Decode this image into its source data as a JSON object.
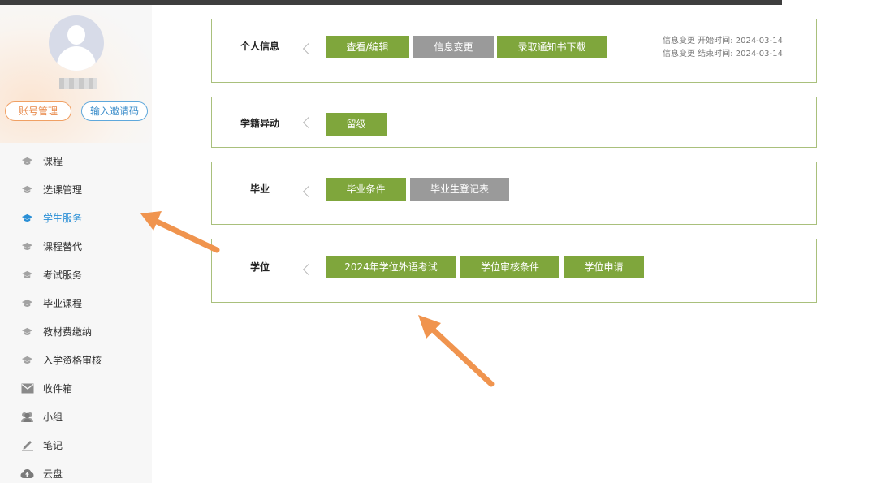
{
  "colors": {
    "accent_green": "#7fa63c",
    "button_gray": "#9a9a9a",
    "active_blue": "#2a8fd6",
    "card_border": "#a9c07c",
    "arrow_orange": "#f0944e"
  },
  "profile": {
    "account_button": "账号管理",
    "invite_button": "输入邀请码"
  },
  "sidebar": {
    "items": [
      {
        "label": "课程",
        "icon": "graduation-cap-icon"
      },
      {
        "label": "选课管理",
        "icon": "graduation-cap-icon"
      },
      {
        "label": "学生服务",
        "icon": "graduation-cap-icon",
        "active": true
      },
      {
        "label": "课程替代",
        "icon": "graduation-cap-icon"
      },
      {
        "label": "考试服务",
        "icon": "graduation-cap-icon"
      },
      {
        "label": "毕业课程",
        "icon": "graduation-cap-icon"
      },
      {
        "label": "教材费缴纳",
        "icon": "graduation-cap-icon"
      },
      {
        "label": "入学资格审核",
        "icon": "graduation-cap-icon"
      },
      {
        "label": "收件箱",
        "icon": "mail-icon"
      },
      {
        "label": "小组",
        "icon": "group-icon"
      },
      {
        "label": "笔记",
        "icon": "pen-icon"
      },
      {
        "label": "云盘",
        "icon": "cloud-upload-icon"
      }
    ]
  },
  "sections": {
    "personal": {
      "title": "个人信息",
      "buttons": [
        "查看/编辑",
        "信息变更",
        "录取通知书下载"
      ],
      "info_start": "信息变更 开始时间: 2024-03-14",
      "info_end": "信息变更 结束时间: 2024-03-14"
    },
    "status": {
      "title": "学籍异动",
      "buttons": [
        "留级"
      ]
    },
    "graduation": {
      "title": "毕业",
      "buttons": [
        "毕业条件",
        "毕业生登记表"
      ]
    },
    "degree": {
      "title": "学位",
      "buttons": [
        "2024年学位外语考试",
        "学位审核条件",
        "学位申请"
      ]
    }
  }
}
